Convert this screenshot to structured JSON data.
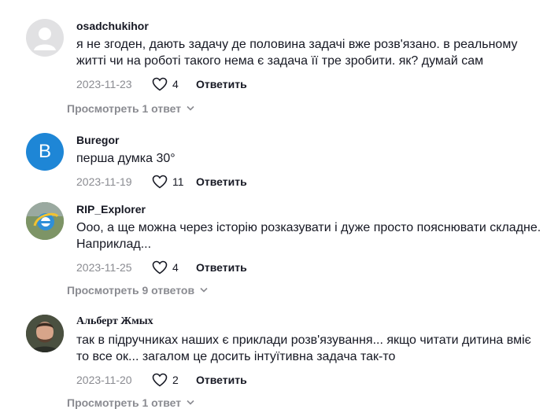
{
  "comments": [
    {
      "username": "osadchukihor",
      "text": "я не згоден, дають задачу де половина задачі вже розв'язано. в реальному житті чи на роботі такого нема є задача її тре зробити. як? думай сам",
      "date": "2023-11-23",
      "likes": "4",
      "reply_label": "Ответить",
      "view_replies": "Просмотреть 1 ответ"
    },
    {
      "username": "Buregor",
      "avatar_letter": "B",
      "text": "перша думка 30°",
      "date": "2023-11-19",
      "likes": "11",
      "reply_label": "Ответить"
    },
    {
      "username": "RIP_Explorer",
      "text": "Ооо, а ще можна через історію розказувати і дуже просто пояснювати складне. Наприклад...",
      "date": "2023-11-25",
      "likes": "4",
      "reply_label": "Ответить",
      "view_replies": "Просмотреть 9 ответов"
    },
    {
      "username": "Альберт Жмых",
      "text": "так в підручниках наших є приклади розв'язування... якщо читати дитина вміє то все ок... загалом це досить інтуїтивна задача так-то",
      "date": "2023-11-20",
      "likes": "2",
      "reply_label": "Ответить",
      "view_replies": "Просмотреть 1 ответ"
    }
  ],
  "colors": {
    "muted": "#8a8b91",
    "text": "#161823",
    "avatar_blue": "#1e86d6",
    "avatar_default": "#e1e1e3"
  },
  "icons": {
    "like": "heart-outline-icon",
    "expand": "chevron-down-icon"
  }
}
